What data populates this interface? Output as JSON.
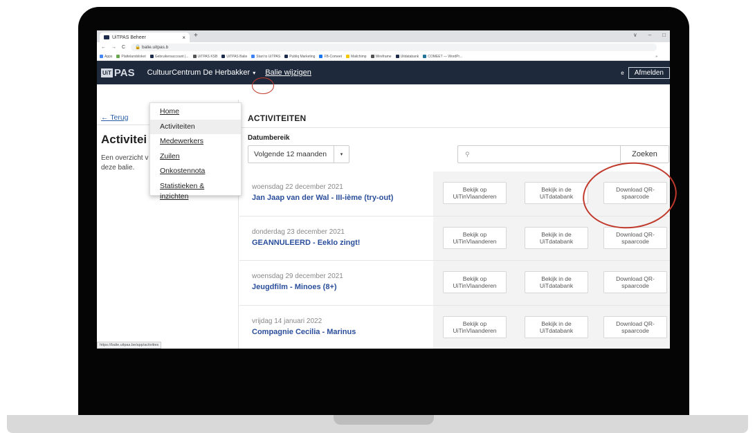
{
  "browser": {
    "tab_title": "UiTPAS Beheer",
    "tab_close": "×",
    "new_tab": "+",
    "window_controls": [
      "∨",
      "–",
      "□"
    ],
    "url": "balie.uitpas.b",
    "nav": [
      "←",
      "→",
      "C"
    ],
    "bookmarks": [
      "Apps",
      "Plattelandsloket",
      "Gebruikersaccount |...",
      "UiTPAS KSB",
      "UiTPAS Balie",
      "Start to UiTPAS",
      "Publiq Marketing",
      "FB-Comeet",
      "Mailchimp",
      "Wireframe",
      "Uitdatabank",
      "COMEET — WordPr..."
    ],
    "bookmarks_more": "»",
    "status_url": "https://balie.uitpas.be/app/activities"
  },
  "header": {
    "logo_uit": "UiT",
    "logo_pas": "PAS",
    "center_name": "CultuurCentrum De Herbakker",
    "center_caret": "▾",
    "balie_link": "Balie wijzigen",
    "user_initial": "e",
    "logout": "Afmelden"
  },
  "menu": {
    "items": [
      "Home",
      "Activiteiten",
      "Medewerkers",
      "Zuilen",
      "Onkostennota",
      "Statistieken & inzichten"
    ]
  },
  "sidebar": {
    "back": "← Terug",
    "title": "Activitei",
    "description": "Een overzicht v deze balie."
  },
  "main": {
    "section_title": "ACTIVITEITEN",
    "date_label": "Datumbereik",
    "date_value": "Volgende 12 maanden",
    "date_caret": "▾",
    "search_icon": "⚲",
    "search_button": "Zoeken",
    "activities": [
      {
        "date": "woensdag 22 december 2021",
        "title": "Jan Jaap van der Wal - III-ième (try-out)"
      },
      {
        "date": "donderdag 23 december 2021",
        "title": "GEANNULEERD - Eeklo zingt!"
      },
      {
        "date": "woensdag 29 december 2021",
        "title": "Jeugdfilm - Minoes (8+)"
      },
      {
        "date": "vrijdag 14 januari 2022",
        "title": "Compagnie Cecilia - Marinus"
      }
    ],
    "action_labels": {
      "view_uit": "Bekijk op UiTinVlaanderen",
      "view_db": "Bekijk in de UiTdatabank",
      "download_qr": "Download QR-spaarcode"
    }
  },
  "annotation_color": "#c0392b"
}
